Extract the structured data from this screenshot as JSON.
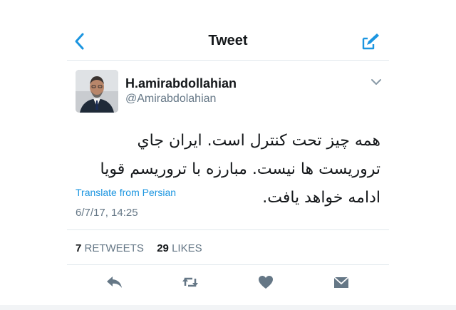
{
  "header": {
    "title": "Tweet",
    "back_icon": "chevron-left-icon",
    "compose_icon": "compose-icon"
  },
  "tweet": {
    "author_name": "H.amirabdollahian",
    "author_handle": "@Amirabdolahian",
    "text": "همه چیز تحت کنترل است. ایران جاي تروریست ها نیست. مبارزه با تروریسم قویا ادامه خواهد یافت.",
    "translate_label": "Translate from Persian",
    "timestamp": "6/7/17, 14:25",
    "retweets_count": "7",
    "retweets_label": "RETWEETS",
    "likes_count": "29",
    "likes_label": "LIKES"
  },
  "actions": [
    "reply-icon",
    "retweet-icon",
    "like-icon",
    "message-icon"
  ],
  "colors": {
    "accent": "#1b95e0",
    "muted": "#657786",
    "icon": "#657786",
    "divider": "#e1e8ed"
  }
}
